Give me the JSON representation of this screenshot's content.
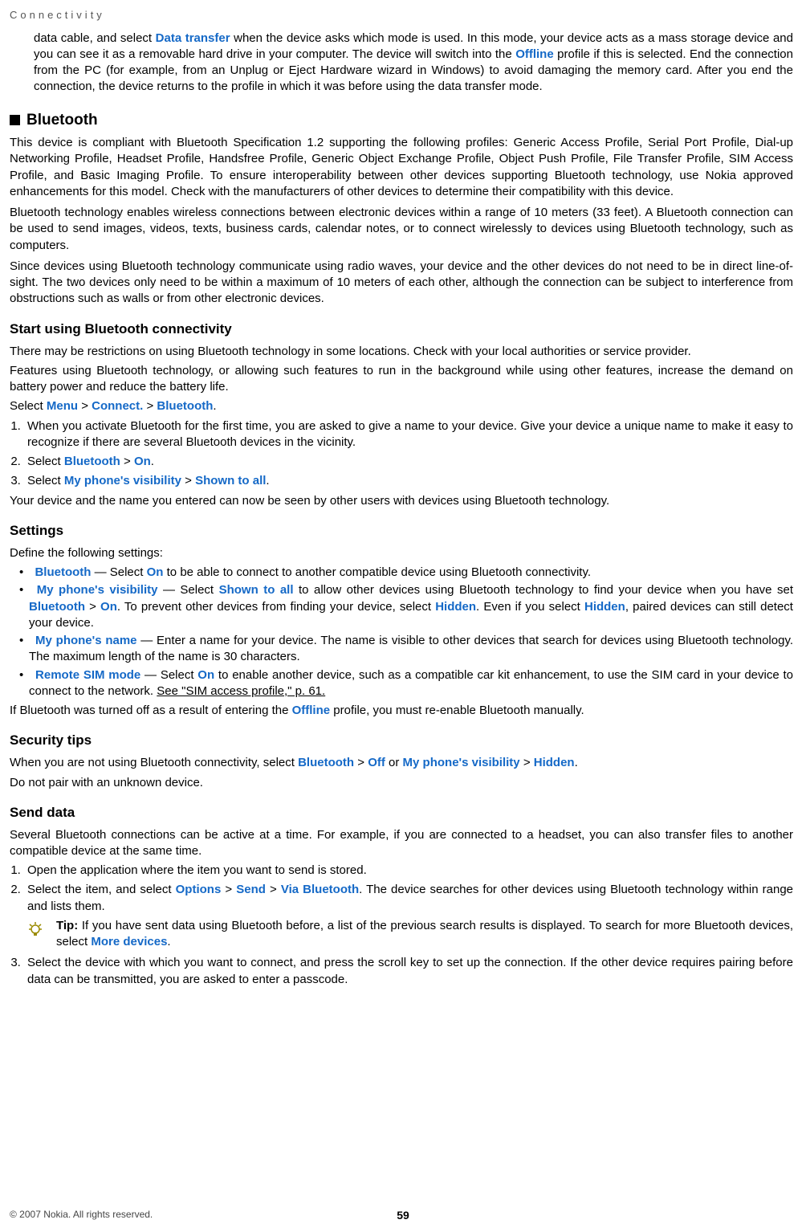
{
  "header": {
    "text": "Connectivity"
  },
  "intro": {
    "para1_a": "data cable, and select ",
    "para1_link": "Data transfer",
    "para1_b": " when the device asks which mode is used. In this mode, your device acts as a mass storage device and you can see it as a removable hard drive in your computer. The device will switch into the ",
    "para1_offline": "Offline",
    "para1_c": " profile if this is selected. End the connection from the PC (for example, from an Unplug or Eject Hardware wizard in Windows) to avoid damaging the memory card. After you end the connection, the device returns to the profile in which it was before using the data transfer mode."
  },
  "bluetooth": {
    "title": "Bluetooth",
    "p1": "This device is compliant with Bluetooth Specification 1.2 supporting the following profiles: Generic Access Profile, Serial Port Profile, Dial-up Networking Profile, Headset Profile, Handsfree Profile, Generic Object Exchange Profile, Object Push Profile, File Transfer Profile, SIM Access Profile, and Basic Imaging Profile. To ensure interoperability between other devices supporting Bluetooth technology, use Nokia approved enhancements for this model. Check with the manufacturers of other devices to determine their compatibility with this device.",
    "p2": "Bluetooth technology enables wireless connections between electronic devices within a range of 10 meters (33 feet). A Bluetooth connection can be used to send images, videos, texts, business cards, calendar notes, or to connect wirelessly to devices using Bluetooth technology, such as computers.",
    "p3": "Since devices using Bluetooth technology communicate using radio waves, your device and the other devices do not need to be in direct line-of-sight. The two devices only need to be within a maximum of 10 meters of each other, although the connection can be subject to interference from obstructions such as walls or from other electronic devices."
  },
  "start": {
    "title": "Start using Bluetooth connectivity",
    "p1": "There may be restrictions on using Bluetooth technology in some locations. Check with your local authorities or service provider.",
    "p2": "Features using Bluetooth technology, or allowing such features to run in the background while using other features, increase the demand on battery power and reduce the battery life.",
    "select_a": "Select ",
    "menu": "Menu",
    "gt": " > ",
    "connect": "Connect.",
    "bluetooth": "Bluetooth",
    "period": ".",
    "step1": "When you activate Bluetooth for the first time, you are asked to give a name to your device. Give your device a unique name to make it easy to recognize if there are several Bluetooth devices in the vicinity.",
    "step2_a": "Select ",
    "step2_bt": "Bluetooth",
    "step2_on": "On",
    "step3_a": "Select ",
    "step3_vis": "My phone's visibility",
    "step3_shown": "Shown to all",
    "after": "Your device and the name you entered can now be seen by other users with devices using Bluetooth technology."
  },
  "settings": {
    "title": "Settings",
    "intro": "Define the following settings:",
    "b1_name": "Bluetooth",
    "b1_a": " — Select ",
    "b1_on": "On",
    "b1_b": " to be able to connect to another compatible device using Bluetooth connectivity.",
    "b2_name": "My phone's visibility",
    "b2_a": " — Select ",
    "b2_shown": "Shown to all",
    "b2_b": " to allow other devices using Bluetooth technology to find your device when you have set ",
    "b2_bt": "Bluetooth",
    "b2_gt": " > ",
    "b2_on": "On",
    "b2_c": ". To prevent other devices from finding your device, select ",
    "b2_hidden1": "Hidden",
    "b2_d": ". Even if you select ",
    "b2_hidden2": "Hidden",
    "b2_e": ", paired devices can still detect your device.",
    "b3_name": "My phone's name",
    "b3_a": " — Enter a name for your device. The name is visible to other devices that search for devices using Bluetooth technology. The maximum length of the name is 30 characters.",
    "b4_name": "Remote SIM mode",
    "b4_a": " — Select ",
    "b4_on": "On",
    "b4_b": " to enable another device, such as a compatible car kit enhancement, to use the SIM card in your device to connect to the network. ",
    "b4_link": "See \"SIM access profile,\" p. 61.",
    "after_a": "If Bluetooth was turned off as a result of entering the ",
    "after_offline": "Offline",
    "after_b": " profile, you must re-enable Bluetooth manually."
  },
  "security": {
    "title": "Security tips",
    "p1_a": "When you are not using Bluetooth connectivity, select ",
    "p1_bt": "Bluetooth",
    "p1_gt": " > ",
    "p1_off": "Off",
    "p1_or": " or ",
    "p1_vis": "My phone's visibility",
    "p1_hidden": "Hidden",
    "p1_period": ".",
    "p2": "Do not pair with an unknown device."
  },
  "send": {
    "title": "Send data",
    "p1": "Several Bluetooth connections can be active at a time. For example, if you are connected to a headset, you can also transfer files to another compatible device at the same time.",
    "s1": "Open the application where the item you want to send is stored.",
    "s2_a": "Select the item, and select ",
    "s2_options": "Options",
    "s2_gt": " > ",
    "s2_send": "Send",
    "s2_via": "Via Bluetooth",
    "s2_b": ". The device searches for other devices using Bluetooth technology within range and lists them.",
    "tip_label": "Tip: ",
    "tip_a": "If you have sent data using Bluetooth before, a list of the previous search results is displayed. To search for more Bluetooth devices, select ",
    "tip_more": "More devices",
    "tip_period": ".",
    "s3": "Select the device with which you want to connect, and press the scroll key to set up the connection. If the other device requires pairing before data can be transmitted, you are asked to enter a passcode."
  },
  "footer": {
    "copyright": "© 2007 Nokia. All rights reserved.",
    "page": "59"
  }
}
